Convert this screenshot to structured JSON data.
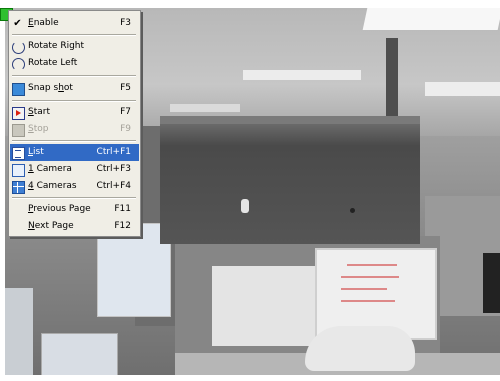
{
  "colors": {
    "menu_background": "#f0eee6",
    "highlight": "#316ac5",
    "disabled_text": "#a5a29a",
    "indicator_green": "#2fbf2f"
  },
  "menu": {
    "items": [
      {
        "label": "Enable",
        "mnemonic": "E",
        "shortcut": "F3",
        "checked": true,
        "icon": "check-icon",
        "enabled": true
      },
      {
        "label": "Rotate Right",
        "shortcut": "",
        "icon": "rotate-right-icon",
        "enabled": true
      },
      {
        "label": "Rotate Left",
        "shortcut": "",
        "icon": "rotate-left-icon",
        "enabled": true
      },
      {
        "label": "Snap shot",
        "mnemonic": "h",
        "shortcut": "F5",
        "icon": "camera-icon",
        "enabled": true
      },
      {
        "label": "Start",
        "mnemonic": "S",
        "shortcut": "F7",
        "icon": "play-icon",
        "enabled": true
      },
      {
        "label": "Stop",
        "mnemonic": "S",
        "shortcut": "F9",
        "icon": "stop-icon",
        "enabled": false
      },
      {
        "label": "List",
        "mnemonic": "L",
        "shortcut": "Ctrl+F1",
        "icon": "list-icon",
        "enabled": true,
        "highlighted": true
      },
      {
        "label": "1 Camera",
        "mnemonic": "1",
        "shortcut": "Ctrl+F3",
        "icon": "single-camera-icon",
        "enabled": true
      },
      {
        "label": "4 Cameras",
        "mnemonic": "4",
        "shortcut": "Ctrl+F4",
        "icon": "quad-camera-icon",
        "enabled": true
      },
      {
        "label": "Previous Page",
        "mnemonic": "P",
        "shortcut": "F11",
        "icon": "",
        "enabled": true
      },
      {
        "label": "Next Page",
        "mnemonic": "N",
        "shortcut": "F12",
        "icon": "",
        "enabled": true
      }
    ]
  },
  "text": {
    "enable_a": "E",
    "enable_b": "nable",
    "enable_key": "F3",
    "rotate_right": "Rotate Right",
    "rotate_left": "Rotate Left",
    "snap_a": "Snap s",
    "snap_b": "h",
    "snap_c": "ot",
    "snap_key": "F5",
    "start_a": "S",
    "start_b": "tart",
    "start_key": "F7",
    "stop_a": "S",
    "stop_b": "top",
    "stop_key": "F9",
    "list_a": "L",
    "list_b": "ist",
    "list_key": "Ctrl+F1",
    "one_a": "1",
    "one_b": " Camera",
    "one_key": "Ctrl+F3",
    "four_a": "4",
    "four_b": " Cameras",
    "four_key": "Ctrl+F4",
    "prev_a": "P",
    "prev_b": "revious Page",
    "prev_key": "F11",
    "next_a": "N",
    "next_b": "ext Page",
    "next_key": "F12"
  }
}
